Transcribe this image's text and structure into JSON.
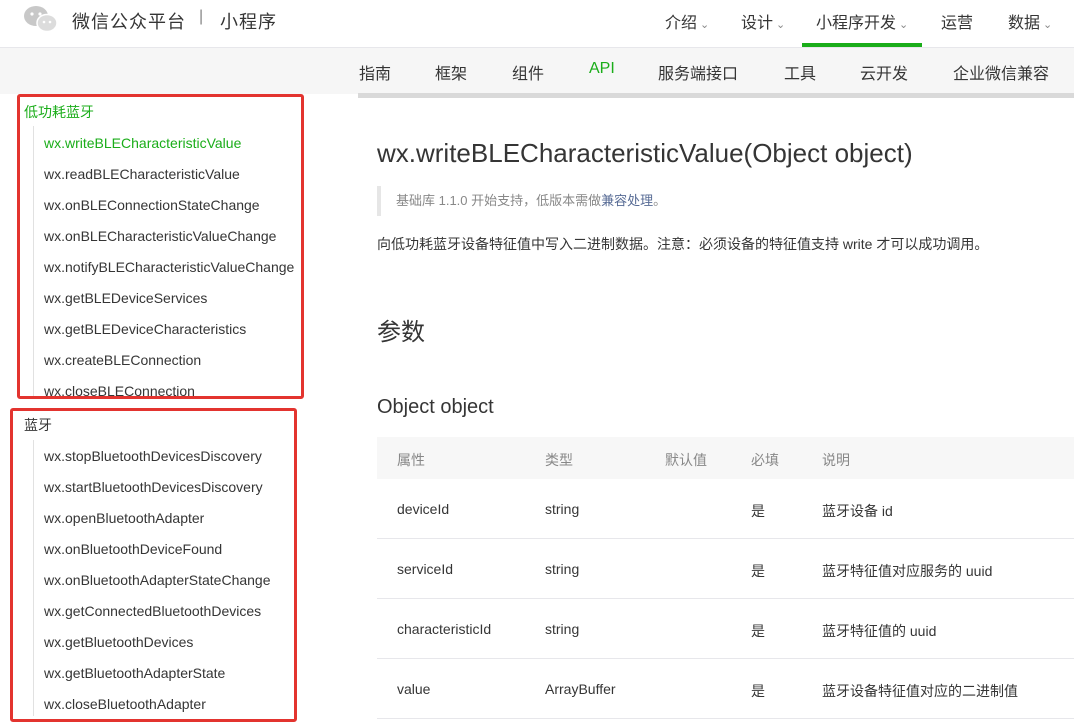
{
  "header": {
    "brand": "微信公众平台",
    "separator": "|",
    "sub_brand": "小程序",
    "nav": [
      {
        "label": "介绍",
        "chevron": "⌄"
      },
      {
        "label": "设计",
        "chevron": "⌄"
      },
      {
        "label": "小程序开发",
        "chevron": "⌄"
      },
      {
        "label": "运营",
        "chevron": ""
      },
      {
        "label": "数据",
        "chevron": "⌄"
      }
    ],
    "active_color": "#1aad19"
  },
  "subnav": [
    "指南",
    "框架",
    "组件",
    "API",
    "服务端接口",
    "工具",
    "云开发",
    "企业微信兼容"
  ],
  "sidebar": {
    "groups": [
      {
        "title": "低功耗蓝牙",
        "items": [
          "wx.writeBLECharacteristicValue",
          "wx.readBLECharacteristicValue",
          "wx.onBLEConnectionStateChange",
          "wx.onBLECharacteristicValueChange",
          "wx.notifyBLECharacteristicValueChange",
          "wx.getBLEDeviceServices",
          "wx.getBLEDeviceCharacteristics",
          "wx.createBLEConnection",
          "wx.closeBLEConnection"
        ]
      },
      {
        "title": "蓝牙",
        "items": [
          "wx.stopBluetoothDevicesDiscovery",
          "wx.startBluetoothDevicesDiscovery",
          "wx.openBluetoothAdapter",
          "wx.onBluetoothDeviceFound",
          "wx.onBluetoothAdapterStateChange",
          "wx.getConnectedBluetoothDevices",
          "wx.getBluetoothDevices",
          "wx.getBluetoothAdapterState",
          "wx.closeBluetoothAdapter"
        ]
      }
    ]
  },
  "main": {
    "title": "wx.writeBLECharacteristicValue(Object object)",
    "support_prefix": "基础库 1.1.0 开始支持，低版本需做",
    "support_link": "兼容处理",
    "support_suffix": "。",
    "description": "向低功耗蓝牙设备特征值中写入二进制数据。注意：必须设备的特征值支持 write 才可以成功调用。",
    "params_heading": "参数",
    "object_heading": "Object object",
    "table": {
      "headers": [
        "属性",
        "类型",
        "默认值",
        "必填",
        "说明"
      ],
      "rows": [
        [
          "deviceId",
          "string",
          "",
          "是",
          "蓝牙设备 id"
        ],
        [
          "serviceId",
          "string",
          "",
          "是",
          "蓝牙特征值对应服务的 uuid"
        ],
        [
          "characteristicId",
          "string",
          "",
          "是",
          "蓝牙特征值的 uuid"
        ],
        [
          "value",
          "ArrayBuffer",
          "",
          "是",
          "蓝牙设备特征值对应的二进制值"
        ]
      ]
    }
  }
}
